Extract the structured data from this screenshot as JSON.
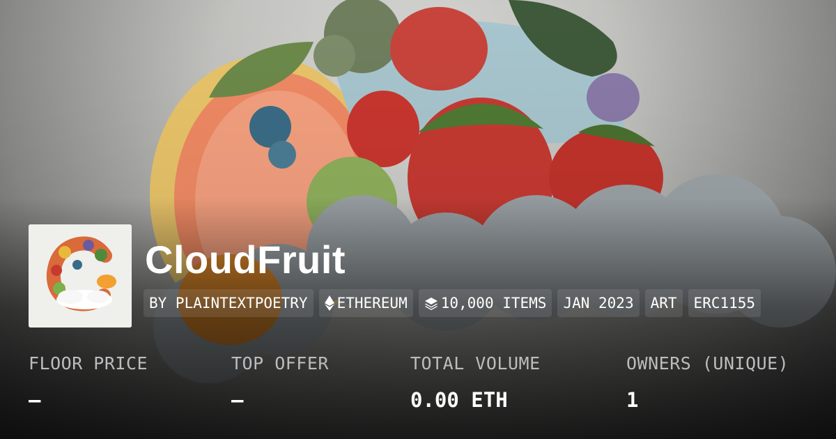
{
  "collection": {
    "name": "CloudFruit",
    "creator": "BY PLAINTEXTPOETRY",
    "chain": "ETHEREUM",
    "items": "10,000 ITEMS",
    "created": "JAN 2023",
    "category": "ART",
    "standard": "ERC1155"
  },
  "icons": {
    "chain": "ethereum-icon",
    "items": "layers-icon"
  },
  "stats": [
    {
      "label": "FLOOR PRICE",
      "value": "–"
    },
    {
      "label": "TOP OFFER",
      "value": "–"
    },
    {
      "label": "TOTAL VOLUME",
      "value": "0.00 ETH"
    },
    {
      "label": "OWNERS (UNIQUE)",
      "value": "1"
    }
  ]
}
